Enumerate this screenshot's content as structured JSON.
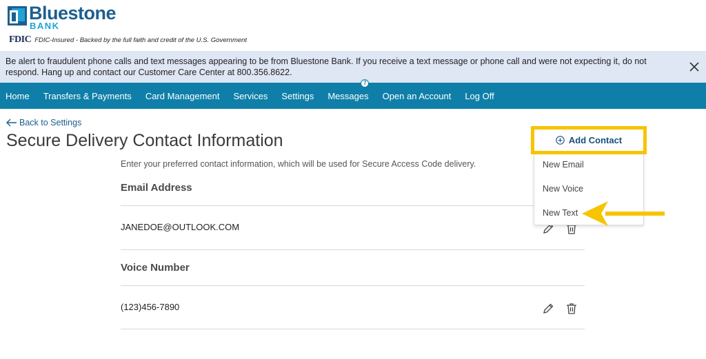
{
  "brand": {
    "name": "Bluestone",
    "sub": "BANK",
    "fdic_mark": "FDIC",
    "fdic_text": "FDIC-Insured - Backed by the full faith and credit of the U.S. Government",
    "colors": {
      "primary": "#1d5f8f",
      "accent": "#1fa3d6",
      "nav": "#0f7fa9",
      "highlight": "#f7c400"
    }
  },
  "alert": {
    "text": "Be alert to fraudulent phone calls and text messages appearing to be from Bluestone Bank. If you receive a text message or phone call and were not expecting it, do not respond. Hang up and contact our Customer Care Center at 800.356.8622.",
    "close_icon": "close-icon"
  },
  "nav": {
    "items": [
      {
        "label": "Home"
      },
      {
        "label": "Transfers & Payments"
      },
      {
        "label": "Card Management"
      },
      {
        "label": "Services"
      },
      {
        "label": "Settings"
      },
      {
        "label": "Messages",
        "badge": "7"
      },
      {
        "label": "Open an Account"
      },
      {
        "label": "Log Off"
      }
    ]
  },
  "main": {
    "back_label": "Back to Settings",
    "title": "Secure Delivery Contact Information",
    "intro": "Enter your preferred contact information, which will be used for Secure Access Code delivery.",
    "sections": [
      {
        "title": "Email Address",
        "value": "JANEDOE@OUTLOOK.COM"
      },
      {
        "title": "Voice Number",
        "value": "(123)456-7890"
      }
    ]
  },
  "add_contact": {
    "label": "Add Contact",
    "menu": [
      {
        "label": "New Email"
      },
      {
        "label": "New Voice"
      },
      {
        "label": "New Text"
      }
    ]
  }
}
